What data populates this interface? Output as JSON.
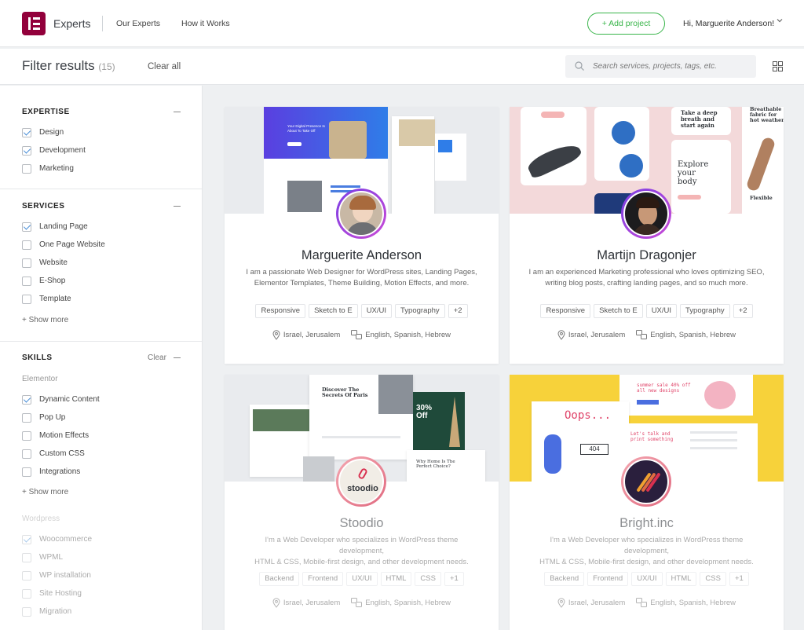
{
  "header": {
    "brand": "Experts",
    "nav": [
      "Our Experts",
      "How it Works"
    ],
    "add_project": "+ Add project",
    "greeting": "Hi, Marguerite Anderson!",
    "accent": "#39b54a",
    "logo_color": "#92003b"
  },
  "filterbar": {
    "title": "Filter results",
    "count": "(15)",
    "clear_all": "Clear all",
    "search_placeholder": "Search services, projects, tags, etc."
  },
  "sidebar": {
    "expertise": {
      "title": "EXPERTISE",
      "options": [
        {
          "label": "Design",
          "checked": true
        },
        {
          "label": "Development",
          "checked": true
        },
        {
          "label": "Marketing",
          "checked": false
        }
      ]
    },
    "services": {
      "title": "SERVICES",
      "options": [
        {
          "label": "Landing Page",
          "checked": true
        },
        {
          "label": "One Page Website",
          "checked": false
        },
        {
          "label": "Website",
          "checked": false
        },
        {
          "label": "E-Shop",
          "checked": false
        },
        {
          "label": "Template",
          "checked": false
        }
      ],
      "show_more": "+ Show more"
    },
    "skills": {
      "title": "SKILLS",
      "clear": "Clear",
      "elementor": {
        "title": "Elementor",
        "options": [
          {
            "label": "Dynamic Content",
            "checked": true
          },
          {
            "label": "Pop Up",
            "checked": false
          },
          {
            "label": "Motion Effects",
            "checked": false
          },
          {
            "label": "Custom CSS",
            "checked": false
          },
          {
            "label": "Integrations",
            "checked": false
          }
        ],
        "show_more": "+ Show more"
      },
      "wordpress": {
        "title": "Wordpress",
        "options": [
          {
            "label": "Woocommerce",
            "checked": true
          },
          {
            "label": "WPML",
            "checked": false
          },
          {
            "label": "WP installation",
            "checked": false
          },
          {
            "label": "Site Hosting",
            "checked": false
          },
          {
            "label": "Migration",
            "checked": false
          }
        ]
      }
    }
  },
  "cards": [
    {
      "name": "Marguerite Anderson",
      "desc_l1": "I am a passionate Web Designer for WordPress sites, Landing Pages,",
      "desc_l2": "Elementor Templates, Theme Building, Motion Effects, and more.",
      "tags": [
        "Responsive",
        "Sketch to E",
        "UX/UI",
        "Typography",
        "+2"
      ],
      "location": "Israel, Jerusalem",
      "languages": "English, Spanish, Hebrew"
    },
    {
      "name": "Martijn Dragonjer",
      "desc_l1": "I am an experienced Marketing professional who loves optimizing SEO,",
      "desc_l2": "writing blog posts, crafting landing pages, and so much more.",
      "tags": [
        "Responsive",
        "Sketch to E",
        "UX/UI",
        "Typography",
        "+2"
      ],
      "location": "Israel, Jerusalem",
      "languages": "English, Spanish, Hebrew"
    },
    {
      "name": "Stoodio",
      "desc_l1": "I'm a Web Developer who specializes in WordPress theme development,",
      "desc_l2": "HTML & CSS, Mobile-first design, and other development needs.",
      "tags": [
        "Backend",
        "Frontend",
        "UX/UI",
        "HTML",
        "CSS",
        "+1"
      ],
      "location": "Israel, Jerusalem",
      "languages": "English, Spanish, Hebrew",
      "logo_text": "stoodio"
    },
    {
      "name": "Bright.inc",
      "desc_l1": "I'm a Web Developer who specializes in WordPress theme development,",
      "desc_l2": "HTML & CSS, Mobile-first design, and other development needs.",
      "tags": [
        "Backend",
        "Frontend",
        "UX/UI",
        "HTML",
        "CSS",
        "+1"
      ],
      "location": "Israel, Jerusalem",
      "languages": "English, Spanish, Hebrew"
    }
  ],
  "banner_text": {
    "c1_hero": "Your Digital Presence Is About To Take Off",
    "c2_a": "Take a deep breath and start again",
    "c2_b": "Explore your body",
    "c2_c": "Breathable fabric for hot weather",
    "c2_d": "Flexible",
    "c3_a": "Discover The Secrets Of Paris",
    "c3_b": "30% Off",
    "c3_c": "Why Home Is The Perfect Choice?",
    "c4_a": "Oops...",
    "c4_b": "404",
    "c4_c": "summer sale 40% off all new designs",
    "c4_d": "Let's talk and print something"
  }
}
